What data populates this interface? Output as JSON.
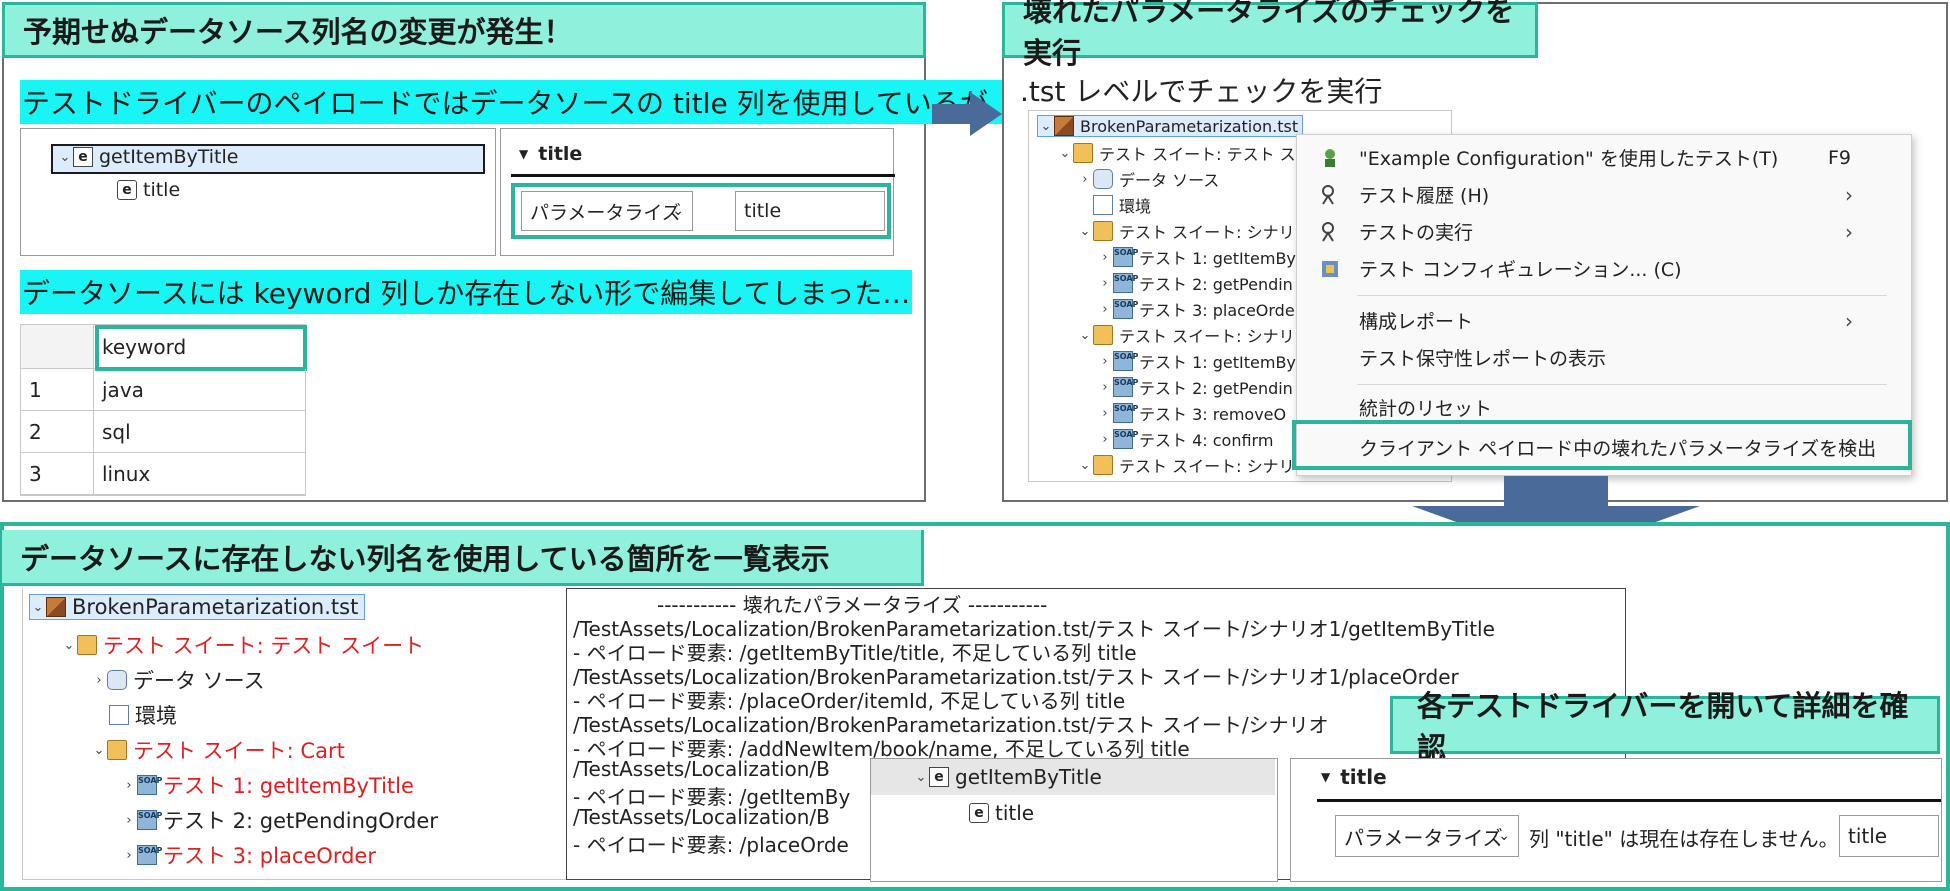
{
  "top_left": {
    "title": "予期せぬデータソース列名の変更が発生！",
    "caption1": "テストドライバーのペイロードではデータソースの title 列を使用しているが、",
    "caption2": "データソースには keyword 列しか存在しない形で編集してしまった…",
    "tree": {
      "root": "getItemByTitle",
      "child": "title"
    },
    "param_panel": {
      "header": "title",
      "mode": "パラメータライズ",
      "value": "title"
    },
    "table": {
      "header": "keyword",
      "rows": [
        {
          "n": "1",
          "v": "java"
        },
        {
          "n": "2",
          "v": "sql"
        },
        {
          "n": "3",
          "v": "linux"
        }
      ]
    }
  },
  "top_right": {
    "title": "壊れたパラメータライズのチェックを実行",
    "subtitle": ".tst レベルでチェックを実行",
    "tree": [
      "BrokenParametarization.tst",
      "テスト スイート: テスト スイー",
      "データ ソース",
      "環境",
      "テスト スイート: シナリオ",
      "テスト 1: getItemBy",
      "テスト 2: getPendin",
      "テスト 3: placeOrde",
      "テスト スイート: シナリオ2",
      "テスト 1: getItemBy",
      "テスト 2: getPendin",
      "テスト 3: removeO",
      "テスト 4: confirm",
      "テスト スイート: シナリオ3"
    ],
    "menu": [
      {
        "label": "\"Example Configuration\" を使用したテスト(T)",
        "shortcut": "F9",
        "icon": "run-config-icon"
      },
      {
        "label": "テスト履歴 (H)",
        "arrow": "›",
        "icon": "history-icon"
      },
      {
        "label": "テストの実行",
        "arrow": "›",
        "icon": "run-icon"
      },
      {
        "label": "テスト コンフィギュレーション... (C)",
        "icon": "config-icon"
      },
      {
        "label": "構成レポート",
        "arrow": "›"
      },
      {
        "label": "テスト保守性レポートの表示"
      },
      {
        "label": "統計のリセット"
      },
      {
        "label": "クライアント ペイロード中の壊れたパラメータライズを検出"
      }
    ]
  },
  "bottom": {
    "title": "データソースに存在しない列名を使用している箇所を一覧表示",
    "tree": [
      "BrokenParametarization.tst",
      "テスト スイート: テスト スイート",
      "データ ソース",
      "環境",
      "テスト スイート: Cart",
      "テスト 1: getItemByTitle",
      "テスト 2: getPendingOrder",
      "テスト 3: placeOrder"
    ],
    "log": [
      "----------- 壊れたパラメータライズ -----------",
      "/TestAssets/Localization/BrokenParametarization.tst/テスト スイート/シナリオ1/getItemByTitle",
      " - ペイロード要素: /getItemByTitle/title, 不足している列 title",
      "/TestAssets/Localization/BrokenParametarization.tst/テスト スイート/シナリオ1/placeOrder",
      " - ペイロード要素: /placeOrder/itemId, 不足している列 title",
      "/TestAssets/Localization/BrokenParametarization.tst/テスト スイート/シナリオ",
      " - ペイロード要素: /addNewItem/book/name, 不足している列 title",
      "/TestAssets/Localization/B",
      " - ペイロード要素: /getItemBy",
      "/TestAssets/Localization/B",
      " - ペイロード要素: /placeOrde"
    ],
    "callout": "各テストドライバーを開いて詳細を確認",
    "detail_tree": {
      "root": "getItemByTitle",
      "child": "title"
    },
    "detail_panel": {
      "header": "title",
      "mode": "パラメータライズ",
      "message": "列 \"title\" は現在は存在しません。",
      "value": "title"
    }
  },
  "colors": {
    "accent": "#2bb59a",
    "title_bg": "#8ff0dc",
    "highlight": "#19f5f5",
    "arrow": "#4a6a9a",
    "error": "#e02020"
  }
}
